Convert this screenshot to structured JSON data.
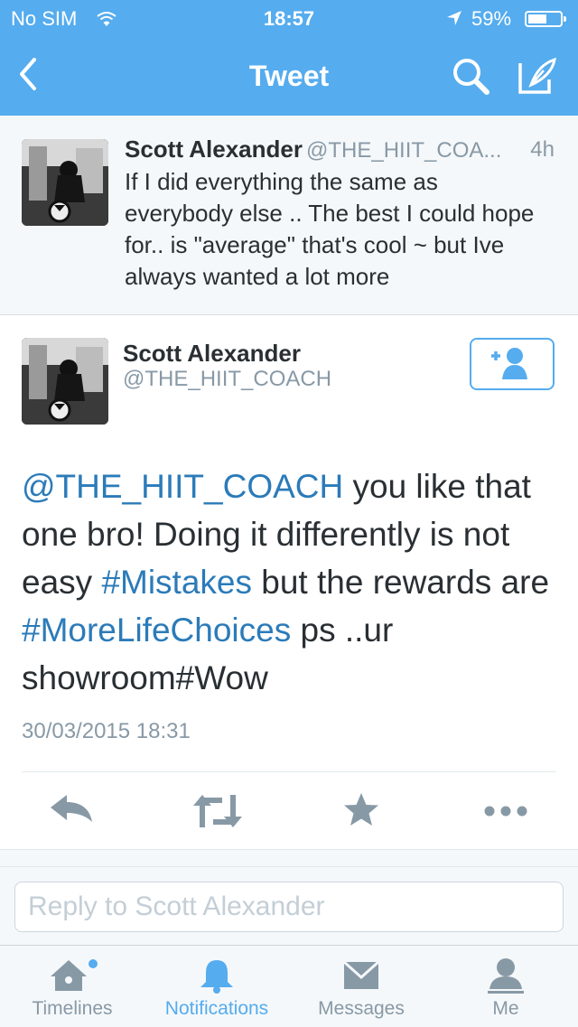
{
  "status_bar": {
    "carrier": "No SIM",
    "time": "18:57",
    "battery": "59%",
    "battery_level": 0.59
  },
  "nav": {
    "title": "Tweet"
  },
  "previous_tweet": {
    "name": "Scott Alexander",
    "handle": "@THE_HIIT_COA...",
    "time": "4h",
    "text": "If I did everything the same as everybody else .. The best I could hope for.. is \"average\" that's cool ~ but Ive always wanted a lot more"
  },
  "main_tweet": {
    "name": "Scott Alexander",
    "handle": "@THE_HIIT_COACH",
    "mention": "@THE_HIIT_COACH",
    "text_1": " you like that one bro! Doing it differently is not easy ",
    "hashtag_1": "#Mistakes",
    "text_2": " but the rewards are ",
    "hashtag_2": "#MoreLifeChoices",
    "text_3": " ps ..ur showroom#Wow",
    "timestamp": "30/03/2015 18:31"
  },
  "reply": {
    "placeholder": "Reply to Scott Alexander"
  },
  "tabs": [
    {
      "label": "Timelines"
    },
    {
      "label": "Notifications"
    },
    {
      "label": "Messages"
    },
    {
      "label": "Me"
    }
  ],
  "colors": {
    "brand": "#55acee",
    "link": "#2b7bb9",
    "muted": "#8899a6",
    "text": "#292f33"
  }
}
